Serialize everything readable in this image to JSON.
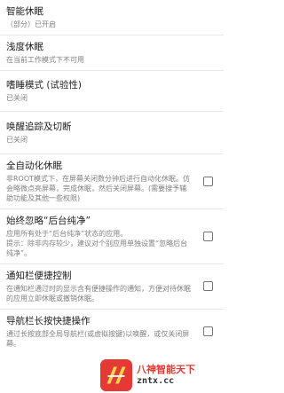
{
  "settings": [
    {
      "title": "智能休眠",
      "summary": "（部分）已开启",
      "has_checkbox": false
    },
    {
      "title": "浅度休眠",
      "summary": "在当前工作模式下不可用",
      "has_checkbox": false
    },
    {
      "title": "嗜睡模式 (试验性)",
      "summary": "已关闭",
      "has_checkbox": false
    },
    {
      "title": "唤醒追踪及切断",
      "summary": "已关闭",
      "has_checkbox": false
    },
    {
      "title": "全自动化休眠",
      "summary": "非ROOT模式下，在屏幕关闭数分钟后进行自动化休眠。仿会略微点亮屏幕，完成休眠，然后关闭屏幕。(需要搜予辅助功能及其他一些权限)",
      "has_checkbox": true,
      "checked": false
    },
    {
      "title": "始终忽略“后台纯净”",
      "summary": "应用所有处于“后台纯净”状态的应用。\n提示：除非内存较少，建议对个别应用单独设置“忽略后台纯净”。",
      "has_checkbox": true,
      "checked": false
    },
    {
      "title": "通知栏便捷控制",
      "summary": "在通知栏通过时的显示含有便捷操作的通知，方便对待休眠的应用立即休眠或撤销休眠。",
      "has_checkbox": true,
      "checked": false
    },
    {
      "title": "导航栏长按快捷操作",
      "summary": "通过长按底部全局导航栏(或虚拟按键)以唤醒，或仅关闭屏幕。",
      "has_checkbox": true,
      "checked": false
    }
  ],
  "watermark": {
    "line1": "八神智能天下",
    "line2": "zntx.cc"
  },
  "colors": {
    "accent": "#e53935",
    "summary": "#808080",
    "divider": "#e6e6e6"
  }
}
